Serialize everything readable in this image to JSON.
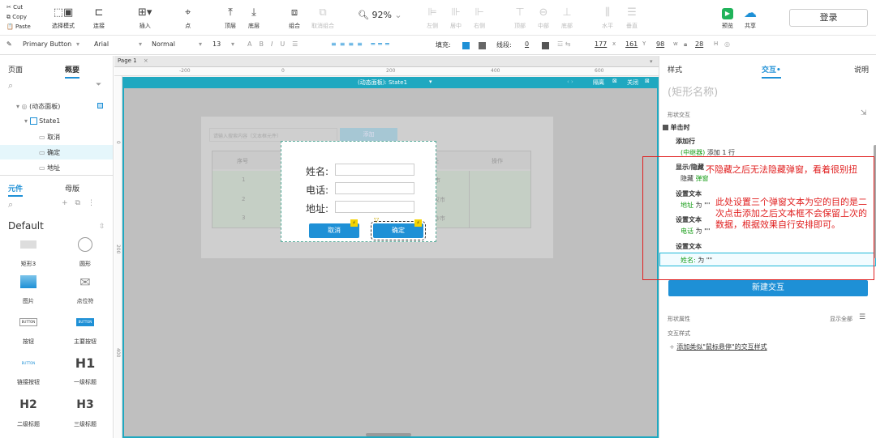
{
  "clipboard": {
    "cut": "Cut",
    "copy": "Copy",
    "paste": "Paste"
  },
  "toolbar": {
    "select_mode": "选择模式",
    "connect": "连接",
    "insert": "插入",
    "point": "点",
    "top": "顶层",
    "bottom": "底层",
    "group": "组合",
    "ungroup": "取消组合",
    "zoom": "92%",
    "align_left": "左侧",
    "align_center": "居中",
    "align_right": "右侧",
    "align_top": "顶部",
    "align_middle": "中部",
    "align_bottom": "底部",
    "h_dist": "水平",
    "v_dist": "垂直",
    "preview": "预览",
    "share": "共享",
    "login": "登录"
  },
  "format": {
    "style": "Primary Button",
    "font": "Arial",
    "weight": "Normal",
    "size": "13",
    "fill_label": "填充:",
    "line_label": "线段:",
    "line_value": "0",
    "x": "177",
    "x_lbl": "x",
    "y": "161",
    "y_lbl": "Y",
    "w": "98",
    "w_lbl": "w",
    "h": "28",
    "h_lbl": "H"
  },
  "left_panel": {
    "tab_pages": "页面",
    "tab_outline": "概要",
    "tree": [
      "(动态面板)",
      "State1",
      "取消",
      "确定",
      "地址"
    ],
    "tab_widgets": "元件",
    "tab_masters": "母版",
    "library": "Default",
    "widgets": [
      "矩形3",
      "圆形",
      "图片",
      "点位符",
      "按钮",
      "主要按钮",
      "链接按钮",
      "一级标题",
      "二级标题",
      "三级标题"
    ],
    "h1": "H1",
    "h2": "H2",
    "h3": "H3",
    "btn_sample": "BUTTON"
  },
  "canvas": {
    "page_tab": "Page 1",
    "ruler": [
      "-200",
      "0",
      "200",
      "400",
      "600"
    ],
    "vruler": [
      "0",
      "200",
      "400"
    ],
    "panel_title": "(动态面板): State1",
    "isolate": "隔离",
    "close": "关闭",
    "bg_search_placeholder": "请输入搜索内容（文本框元件）",
    "bg_add": "添加",
    "bg_headers": [
      "序号",
      "",
      "",
      "址",
      "操作"
    ],
    "bg_rows": [
      [
        "1",
        "",
        "",
        "市",
        ""
      ],
      [
        "2",
        "",
        "",
        "武汉市",
        ""
      ],
      [
        "3",
        "",
        "",
        "长沙市",
        ""
      ]
    ],
    "dlg_name": "姓名:",
    "dlg_phone": "电话:",
    "dlg_addr": "地址:",
    "cancel": "取消",
    "ok": "确定"
  },
  "right_panel": {
    "tab_style": "样式",
    "tab_interact": "交互",
    "tab_notes": "说明",
    "shape_name": "(矩形名称)",
    "section": "形状交互",
    "event": "单击时",
    "a1": "添加行",
    "a1_target": "(中继器)",
    "a1_text": "添加 1 行",
    "a2": "显示/隐藏",
    "a2_text": "隐藏",
    "a2_target": "弹窗",
    "a3": "设置文本",
    "a3_target": "地址",
    "a3_text": "为 \"\"",
    "a4": "设置文本",
    "a4_target": "电话",
    "a4_text": "为 \"\"",
    "a5": "设置文本",
    "a5_target": "姓名:",
    "a5_text": "为 \"\"",
    "new_interaction": "新建交互",
    "props": "形状属性",
    "show_all": "显示全部",
    "interact_style": "交互样式",
    "add_style": "添加类似\"鼠标悬停\"的交互样式"
  },
  "annotations": {
    "note1": "不隐藏之后无法隐藏弹窗，看着很别扭",
    "note2": "此处设置三个弹窗文本为空的目的是二次点击添加之后文本框不会保留上次的数据，根据效果自行安排即可。"
  },
  "colors": {
    "accent": "#1e90d6",
    "teal": "#1fa8c0",
    "green": "#1a9e1a",
    "red": "#e02020"
  }
}
